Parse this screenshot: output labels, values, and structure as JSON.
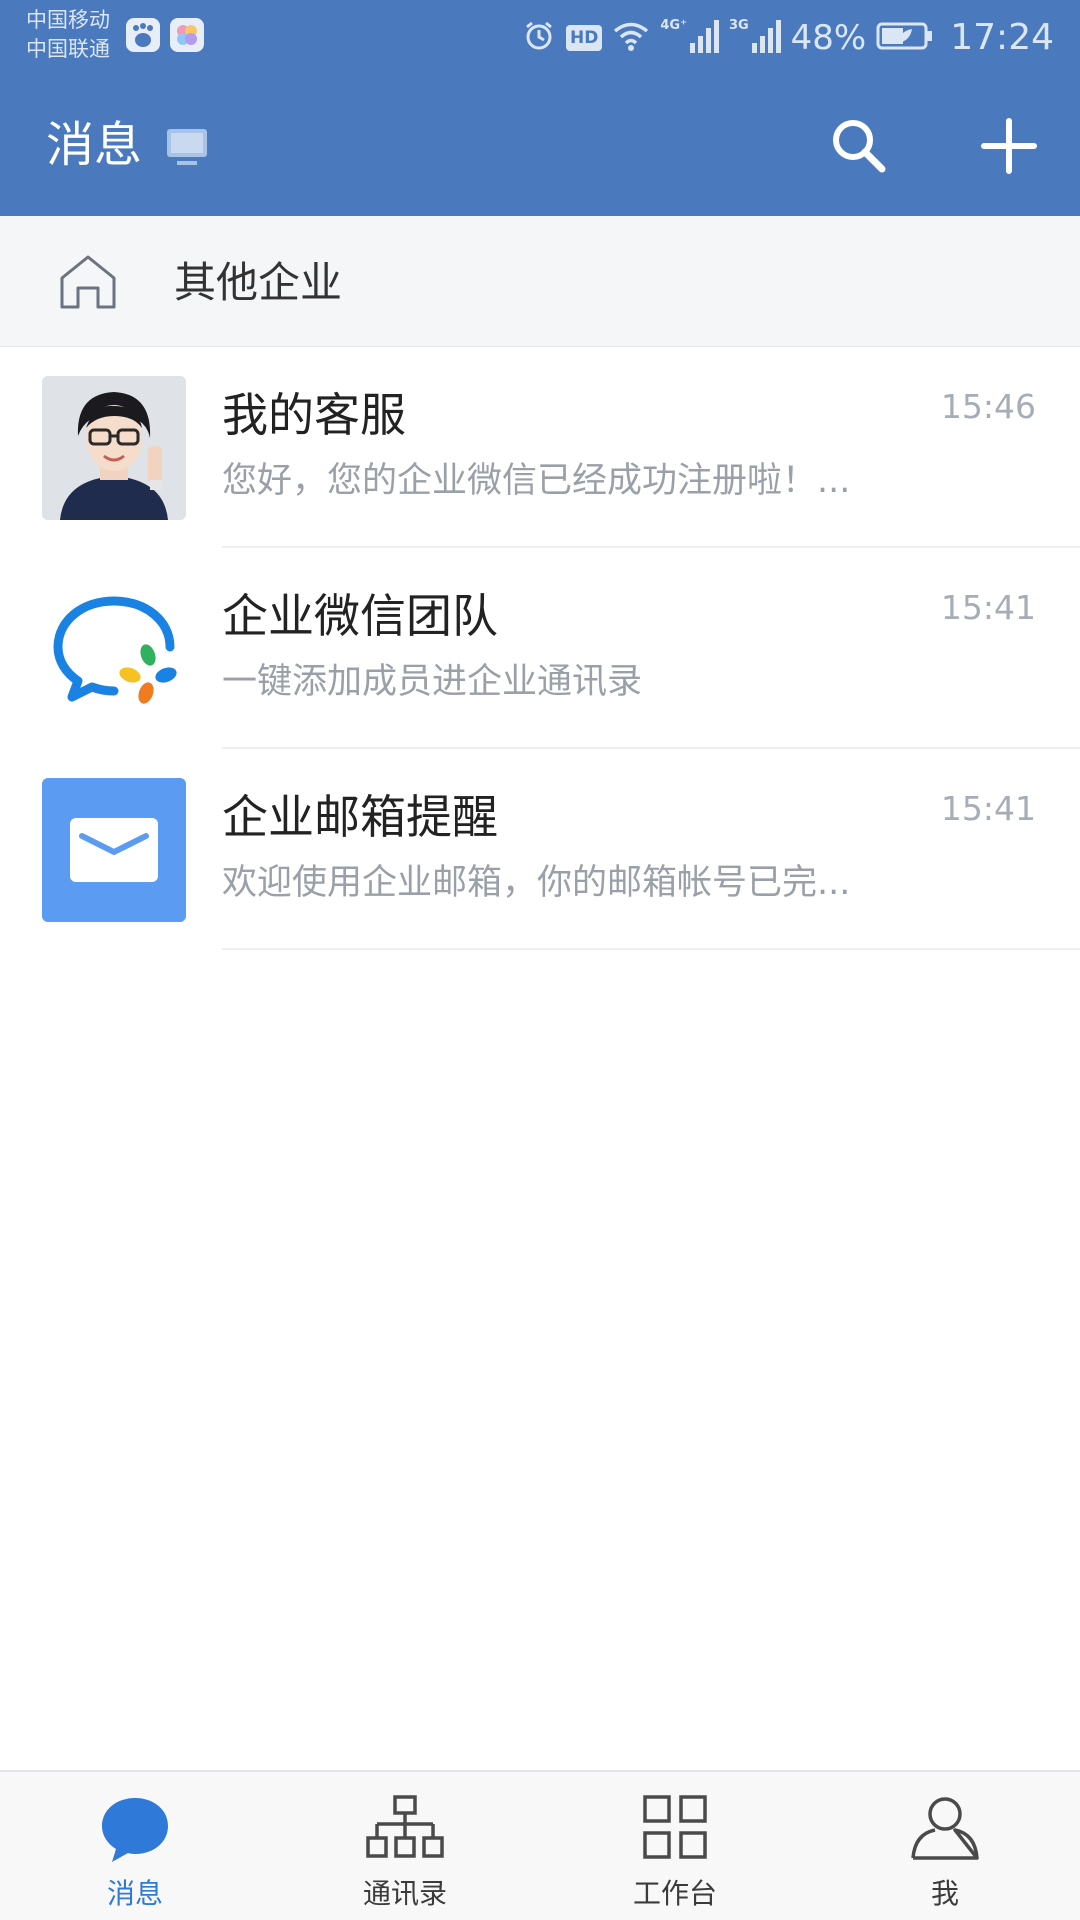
{
  "status_bar": {
    "carrier_1": "中国移动",
    "carrier_2": "中国联通",
    "hd_badge": "HD",
    "network_1": "4G⁺",
    "network_2": "3G",
    "battery": "48%",
    "time": "17:24"
  },
  "header": {
    "title": "消息"
  },
  "other_enterprise": {
    "label": "其他企业"
  },
  "chats": [
    {
      "name": "我的客服",
      "preview": "您好，您的企业微信已经成功注册啦！...",
      "time": "15:46",
      "avatar": "person-photo"
    },
    {
      "name": "企业微信团队",
      "preview": "一键添加成员进企业通讯录",
      "time": "15:41",
      "avatar": "wecom-logo"
    },
    {
      "name": "企业邮箱提醒",
      "preview": "欢迎使用企业邮箱，你的邮箱帐号已完...",
      "time": "15:41",
      "avatar": "mail-icon"
    }
  ],
  "bottom_nav": {
    "tabs": [
      {
        "label": "消息",
        "icon": "chat-bubble-icon",
        "active": true
      },
      {
        "label": "通讯录",
        "icon": "org-chart-icon",
        "active": false
      },
      {
        "label": "工作台",
        "icon": "grid-icon",
        "active": false
      },
      {
        "label": "我",
        "icon": "person-icon",
        "active": false
      }
    ]
  },
  "colors": {
    "header_bg": "#4a79be",
    "accent": "#2f7ad8",
    "mail_tile": "#5b9cf2"
  }
}
